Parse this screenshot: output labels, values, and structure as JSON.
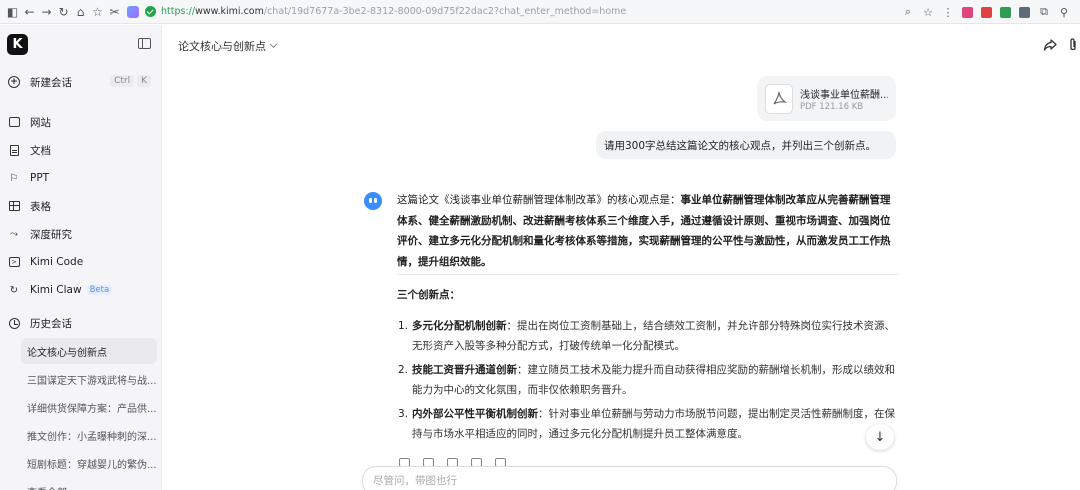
{
  "browser": {
    "url_scheme": "https://",
    "url_host": "www.kimi.com",
    "url_path": "/chat/19d7677a-3be2-8312-8000-09d75f22dac2?chat_enter_method=home"
  },
  "sidebar": {
    "logo": "K",
    "new_chat": {
      "label": "新建会话",
      "shortcut_ctrl": "Ctrl",
      "shortcut_key": "K"
    },
    "items": [
      {
        "label": "网站",
        "icon": "website-icon"
      },
      {
        "label": "文档",
        "icon": "document-icon"
      },
      {
        "label": "PPT",
        "icon": "ppt-icon"
      },
      {
        "label": "表格",
        "icon": "table-icon"
      },
      {
        "label": "深度研究",
        "icon": "research-icon"
      },
      {
        "label": "Kimi Code",
        "icon": "code-icon"
      },
      {
        "label": "Kimi Claw",
        "icon": "claw-icon",
        "badge": "Beta"
      }
    ],
    "history_label": "历史会话",
    "history": [
      "论文核心与创新点",
      "三国谋定天下游戏武将与战...",
      "详细供货保障方案：产品供...",
      "推文创作：小孟曝种刺的深...",
      "短剧标题：穿越婴儿的繁伪...",
      "查看全部"
    ]
  },
  "header": {
    "title": "论文核心与创新点"
  },
  "attachment": {
    "name": "浅谈事业单位薪酬...",
    "meta": "PDF 121.16 KB"
  },
  "user_message": "请用300字总结这篇论文的核心观点，并列出三个创新点。",
  "answer": {
    "intro": "这篇论文《浅谈事业单位薪酬管理体制改革》的核心观点是：",
    "summary_bold": "事业单位薪酬管理体制改革应从完善薪酬管理体系、健全薪酬激励机制、改进薪酬考核体系三个维度入手，通过遵循设计原则、重视市场调查、加强岗位评价、建立多元化分配机制和量化考核体系等措施，实现薪酬管理的公平性与激励性，从而激发员工工作热情，提升组织效能。",
    "section_title": "三个创新点：",
    "points": [
      {
        "num": "1.",
        "head": "多元化分配机制创新",
        "text": "：提出在岗位工资制基础上，结合绩效工资制，并允许部分特殊岗位实行技术资源、无形资产入股等多种分配方式，打破传统单一化分配模式。"
      },
      {
        "num": "2.",
        "head": "技能工资晋升通道创新",
        "text": "：建立随员工技术及能力提升而自动获得相应奖励的薪酬增长机制，形成以绩效和能力为中心的文化氛围，而非仅依赖职务晋升。"
      },
      {
        "num": "3.",
        "head": "内外部公平性平衡机制创新",
        "text": "：针对事业单位薪酬与劳动力市场脱节问题，提出制定灵活性薪酬制度，在保持与市场水平相适应的同时，通过多元化分配机制提升员工整体满意度。"
      }
    ]
  },
  "input": {
    "placeholder": "尽管问，带图也行"
  },
  "colors": {
    "accent": "#3a8dff",
    "sidebar_bg": "#f5f5f7",
    "bubble_bg": "#f1f2f4"
  }
}
